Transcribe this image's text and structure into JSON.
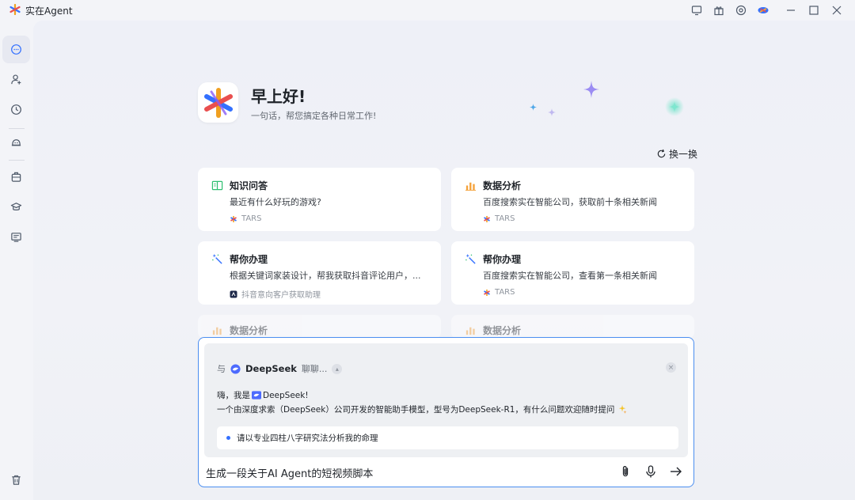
{
  "app": {
    "title": "实在Agent"
  },
  "hero": {
    "greeting": "早上好!",
    "subtitle": "一句话，帮您搞定各种日常工作!"
  },
  "swap_label": "换一换",
  "cards": [
    {
      "title": "知识问答",
      "desc": "最近有什么好玩的游戏?",
      "source": "TARS",
      "icon": "book-icon"
    },
    {
      "title": "数据分析",
      "desc": "百度搜索实在智能公司，获取前十条相关新闻",
      "source": "TARS",
      "icon": "bar-chart-icon"
    },
    {
      "title": "帮你办理",
      "desc": "根据关键词家装设计，帮我获取抖音评论用户，...",
      "source": "抖音意向客户获取助理",
      "icon": "magic-wand-icon"
    },
    {
      "title": "帮你办理",
      "desc": "百度搜索实在智能公司，查看第一条相关新闻",
      "source": "TARS",
      "icon": "magic-wand-icon"
    },
    {
      "title": "数据分析",
      "icon": "bar-chart-icon"
    },
    {
      "title": "数据分析",
      "icon": "bar-chart-icon"
    }
  ],
  "chat": {
    "with_label": "与",
    "model_name": "DeepSeek",
    "chat_label": "聊聊...",
    "intro_prefix": "嗨，我是",
    "intro_name": "DeepSeek!",
    "intro_line2": "一个由深度求索（DeepSeek）公司开发的智能助手模型，型号为DeepSeek-R1，有什么问题欢迎随时提问",
    "suggestion": "请以专业四柱八字研究法分析我的命理",
    "input_value": "生成一段关于AI Agent的短视频脚本"
  },
  "colors": {
    "accent": "#3370ff",
    "border_focus": "#4b8ef0",
    "card_icon_green": "#2fbf71",
    "card_icon_orange": "#f5a23a",
    "card_icon_blue": "#3370ff"
  }
}
